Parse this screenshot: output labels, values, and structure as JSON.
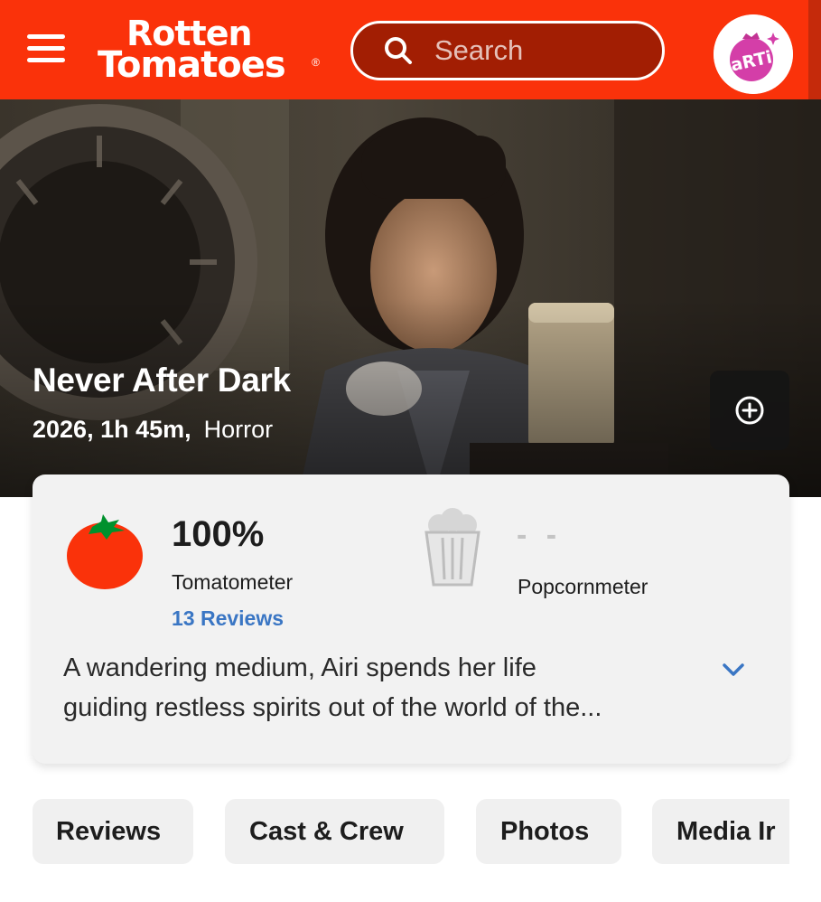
{
  "header": {
    "logo_line1": "Rotten",
    "logo_line2": "Tomatoes",
    "logo_registered": "®",
    "search_placeholder": "Search",
    "avatar_text": "aRTi",
    "brand_color": "#fa320a"
  },
  "hero": {
    "title": "Never After Dark",
    "year_runtime": "2026, 1h 45m,",
    "genre": "Horror"
  },
  "scores": {
    "tomatometer_value": "100%",
    "tomatometer_label": "Tomatometer",
    "reviews_link": "13 Reviews",
    "popcornmeter_value": "- -",
    "popcornmeter_label": "Popcornmeter"
  },
  "synopsis": {
    "line1": "A wandering medium, Airi spends her life",
    "line2": "guiding restless spirits out of the world of the..."
  },
  "tabs": [
    {
      "label": "Reviews"
    },
    {
      "label": "Cast & Crew"
    },
    {
      "label": "Photos"
    },
    {
      "label": "Media Ir"
    }
  ],
  "icons": {
    "menu": "hamburger-icon",
    "search": "search-icon",
    "add": "add-circle-icon",
    "expand": "chevron-down-icon",
    "tomato": "fresh-tomato-icon",
    "popcorn": "empty-popcorn-icon"
  }
}
